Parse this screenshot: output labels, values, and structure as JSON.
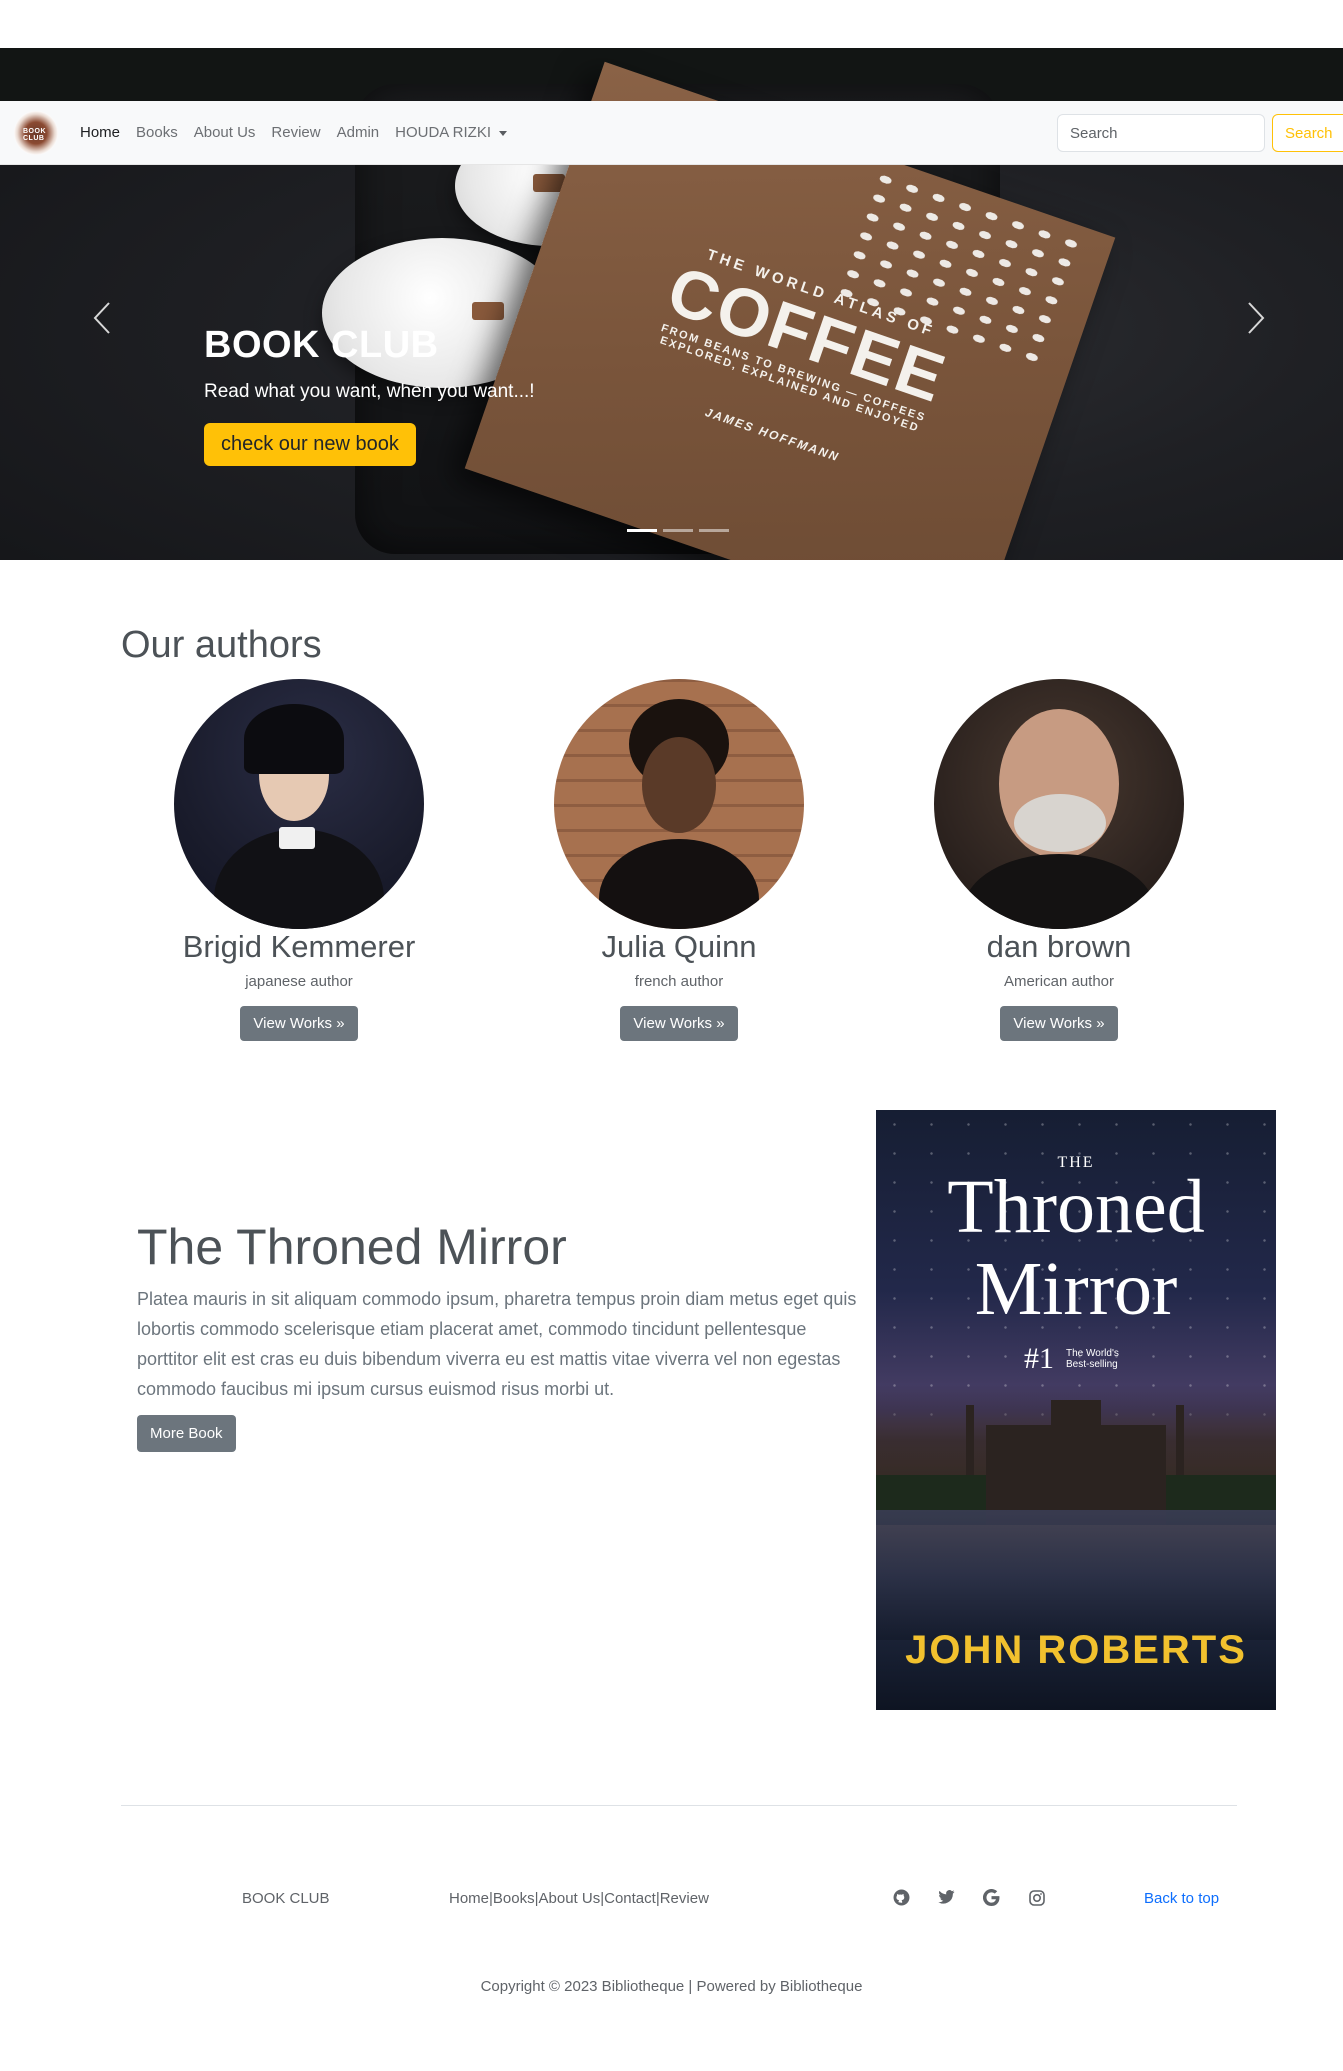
{
  "navbar": {
    "logo_text": "BOOK CLUB",
    "links": [
      "Home",
      "Books",
      "About Us",
      "Review",
      "Admin"
    ],
    "user_menu": "HOUDA RIZKI",
    "search_placeholder": "Search",
    "search_button": "Search"
  },
  "hero": {
    "title": "BOOK CLUB",
    "subtitle": "Read what you want, when you want...!",
    "cta": "check our new book",
    "book_overline": "THE WORLD ATLAS OF",
    "book_title": "COFFEE",
    "book_subtitle": "FROM BEANS TO BREWING — COFFEES EXPLORED, EXPLAINED AND ENJOYED",
    "book_author": "JAMES HOFFMANN",
    "prev_icon": "chevron-left-icon",
    "next_icon": "chevron-right-icon",
    "slides": 3,
    "active_slide": 1
  },
  "authors": {
    "heading": "Our authors",
    "items": [
      {
        "name": "Brigid Kemmerer",
        "role": "japanese author",
        "button": "View Works »"
      },
      {
        "name": "Julia Quinn",
        "role": "french author",
        "button": "View Works »"
      },
      {
        "name": "dan brown",
        "role": "American author",
        "button": "View Works »"
      }
    ]
  },
  "feature": {
    "title": "The Throned Mirror",
    "text": "Platea mauris in sit aliquam commodo ipsum, pharetra tempus proin diam metus eget quis lobortis commodo scelerisque etiam placerat amet, commodo tincidunt pellentesque porttitor elit est cras eu duis bibendum viverra eu est mattis vitae viverra vel non egestas commodo faucibus mi ipsum cursus euismod risus morbi ut.",
    "button": "More Book",
    "cover": {
      "the": "THE",
      "title_line1": "Throned",
      "title_line2": "Mirror",
      "rank": "#1",
      "rank_sub": "The World's Best-selling",
      "author": "JOHN ROBERTS"
    }
  },
  "footer": {
    "brand": "BOOK CLUB",
    "links": [
      "Home|",
      " Books|",
      " About Us|",
      " Contact|",
      " Review"
    ],
    "social_icons": [
      "github-icon",
      "twitter-icon",
      "google-icon",
      "instagram-icon"
    ],
    "back_to_top": "Back to top",
    "copyright": "Copyright © 2023 Bibliotheque | Powered by Bibliotheque"
  },
  "colors": {
    "accent": "#ffc107",
    "secondary_button": "#6c757d",
    "link": "#0d6efd"
  }
}
